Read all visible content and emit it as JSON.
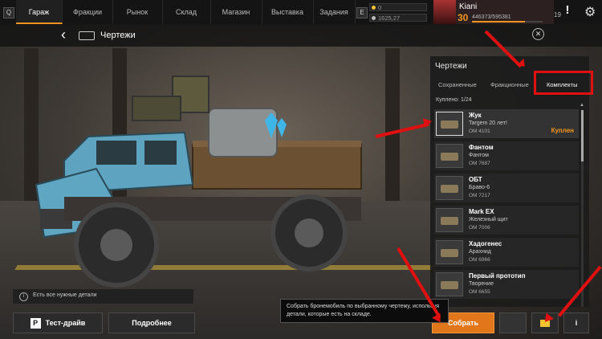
{
  "nav": {
    "key_left": "Q",
    "tabs": [
      {
        "label": "Гараж",
        "active": true
      },
      {
        "label": "Фракции",
        "active": false
      },
      {
        "label": "Рынок",
        "active": false
      },
      {
        "label": "Склад",
        "active": false
      },
      {
        "label": "Магазин",
        "active": false
      },
      {
        "label": "Выставка",
        "active": false
      },
      {
        "label": "Задания",
        "active": false
      }
    ],
    "key_right": "E",
    "resources": [
      {
        "value": "0",
        "color": "#f2c230"
      },
      {
        "value": "1625,27",
        "color": "#bbbbbb"
      }
    ],
    "player": {
      "name": "Kiani",
      "level": "30",
      "exp": "446373/595381",
      "exp_fraction": 0.75
    },
    "notifications": "19",
    "alert_icon": "exclamation-icon",
    "settings_icon": "gear-icon"
  },
  "header": {
    "title": "Чертежи",
    "back_icon": "chevron-left-icon",
    "vehicle_icon": "truck-icon",
    "close_icon": "close-icon"
  },
  "panel": {
    "title": "Чертежи",
    "tabs": [
      {
        "label": "Сохраненные",
        "active": false
      },
      {
        "label": "Фракционные",
        "active": false
      },
      {
        "label": "Комплекты",
        "active": true
      }
    ],
    "bought": "Куплено: 1/24",
    "items": [
      {
        "name": "Жук",
        "sub": "Targem 20 лет!",
        "om": "ОМ 4101",
        "status": "Куплен",
        "selected": true
      },
      {
        "name": "Фантом",
        "sub": "Фантом",
        "om": "ОМ 7687",
        "status": "",
        "selected": false
      },
      {
        "name": "ОБТ",
        "sub": "Браво-6",
        "om": "ОМ 7217",
        "status": "",
        "selected": false
      },
      {
        "name": "Mark EX",
        "sub": "Железный щит",
        "om": "ОМ 7006",
        "status": "",
        "selected": false
      },
      {
        "name": "Хадогенес",
        "sub": "Арахнид",
        "om": "ОМ 6966",
        "status": "",
        "selected": false
      },
      {
        "name": "Первый прототип",
        "sub": "Творение",
        "om": "ОМ 6655",
        "status": "",
        "selected": false
      }
    ]
  },
  "bottom": {
    "info_icon": "info-icon",
    "info_text": "Есть все нужные детали",
    "test_drive_key": "P",
    "test_drive": "Тест-драйв",
    "details": "Подробнее",
    "build": "Собрать",
    "tooltip": "Собрать бронемобиль по выбранному чертежу, используя детали, которые есть на складе.",
    "info_button": "i",
    "folder_icon": "folder-icon"
  },
  "colors": {
    "accent": "#f29421",
    "highlight": "#e01010"
  }
}
